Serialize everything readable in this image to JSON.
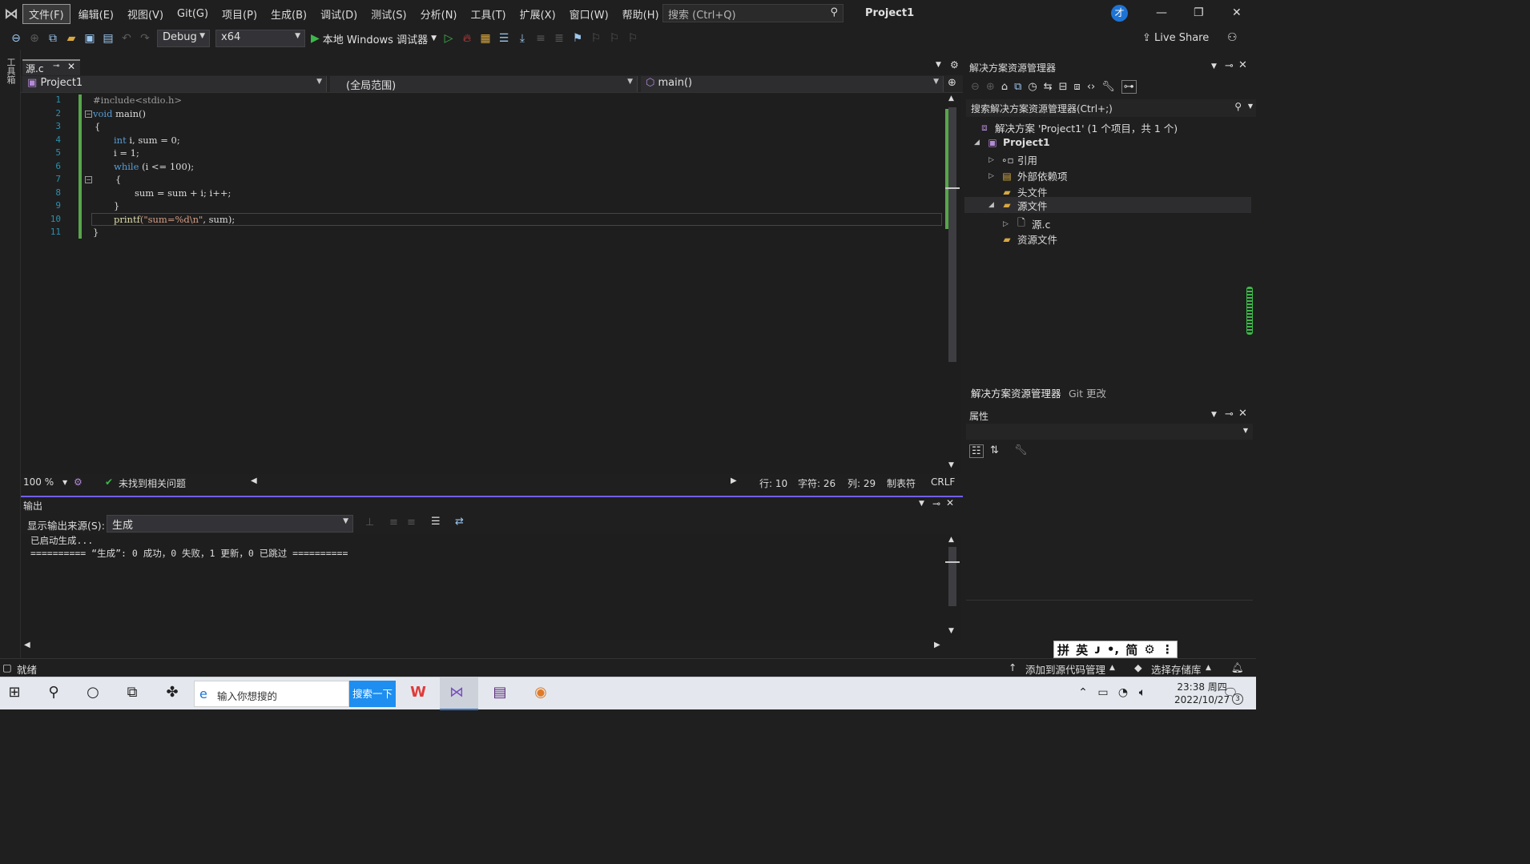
{
  "menubar": {
    "items": [
      "文件(F)",
      "编辑(E)",
      "视图(V)",
      "Git(G)",
      "项目(P)",
      "生成(B)",
      "调试(D)",
      "测试(S)",
      "分析(N)",
      "工具(T)",
      "扩展(X)",
      "窗口(W)",
      "帮助(H)"
    ],
    "search_placeholder": "搜索 (Ctrl+Q)",
    "project_title": "Project1",
    "avatar_text": "才"
  },
  "toolbar": {
    "config": "Debug",
    "platform": "x64",
    "run_label": "本地 Windows 调试器",
    "live_share": "Live Share"
  },
  "left_strip": {
    "label": "工具箱"
  },
  "editor": {
    "tab_name": "源.c",
    "nav_project": "Project1",
    "nav_scope": "(全局范围)",
    "nav_member": "main()",
    "lines": [
      "1",
      "2",
      "3",
      "4",
      "5",
      "6",
      "7",
      "8",
      "9",
      "10",
      "11"
    ],
    "code": {
      "l1": "#include<stdio.h>",
      "l2_kw": "void",
      "l2_rest": " main()",
      "l3": "{",
      "l4_kw": "int",
      "l4_rest": " i, sum = 0;",
      "l5": "i = 1;",
      "l6_kw": "while",
      "l6_rest": " (i <= 100);",
      "l7": "{",
      "l8": "sum = sum + i; i++;",
      "l9": "}",
      "l10_fn": "printf",
      "l10_str": "(\"sum=%d\\n\"",
      "l10_rest": ", sum);",
      "l11": "}"
    }
  },
  "editor_status": {
    "zoom": "100 %",
    "issues": "未找到相关问题",
    "line": "行: 10",
    "char": "字符: 26",
    "col": "列: 29",
    "tabs": "制表符",
    "eol": "CRLF"
  },
  "output": {
    "title": "输出",
    "source_label": "显示输出来源(S):",
    "source_value": "生成",
    "line1": "已启动生成...",
    "line2": "========== “生成”: 0 成功，0 失败，1 更新，0 已跳过 =========="
  },
  "solution_explorer": {
    "title": "解决方案资源管理器",
    "search_placeholder": "搜索解决方案资源管理器(Ctrl+;)",
    "solution": "解决方案 'Project1' (1 个项目，共 1 个)",
    "project": "Project1",
    "items": [
      "引用",
      "外部依赖项",
      "头文件",
      "源文件",
      "源.c",
      "资源文件"
    ],
    "tab_solution": "解决方案资源管理器",
    "tab_git": "Git 更改"
  },
  "properties": {
    "title": "属性"
  },
  "statusbar": {
    "ready": "就绪",
    "add_source": "添加到源代码管理",
    "select_repo": "选择存储库"
  },
  "ime": {
    "chars": [
      "拼",
      "英",
      "ᴊ",
      "•,",
      "简",
      "⚙",
      "⋮"
    ]
  },
  "taskbar": {
    "search_placeholder": "输入你想搜的",
    "search_button": "搜索一下",
    "time": "23:38 周四",
    "date": "2022/10/27",
    "notif_count": "3"
  }
}
